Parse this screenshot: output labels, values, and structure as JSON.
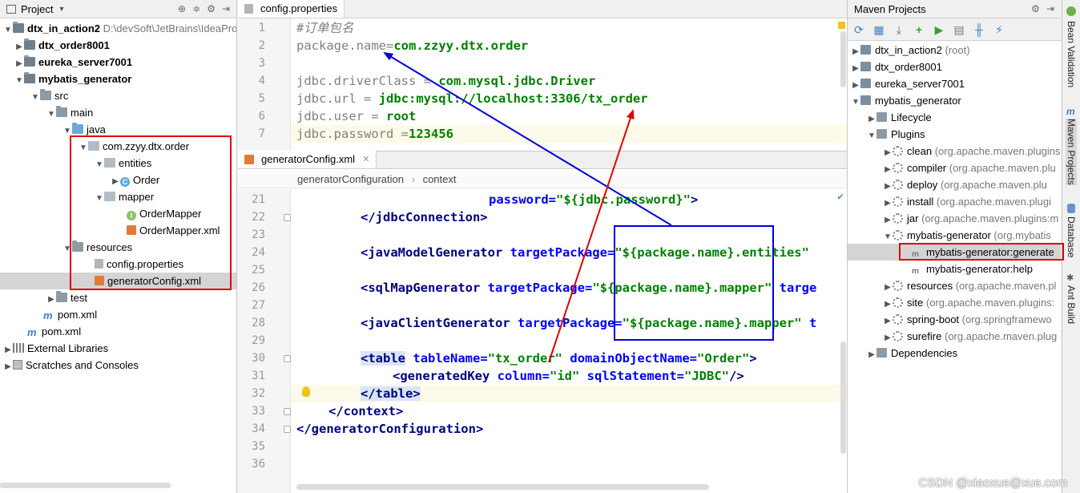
{
  "project": {
    "header_title": "Project",
    "tree": [
      {
        "label": "dtx_in_action2",
        "path": "D:\\devSoft\\JetBrains\\IdeaPro"
      },
      {
        "label": "dtx_order8001"
      },
      {
        "label": "eureka_server7001"
      },
      {
        "label": "mybatis_generator"
      },
      {
        "label": "src"
      },
      {
        "label": "main"
      },
      {
        "label": "java"
      },
      {
        "label": "com.zzyy.dtx.order"
      },
      {
        "label": "entities"
      },
      {
        "label": "Order"
      },
      {
        "label": "mapper"
      },
      {
        "label": "OrderMapper"
      },
      {
        "label": "OrderMapper.xml"
      },
      {
        "label": "resources"
      },
      {
        "label": "config.properties"
      },
      {
        "label": "generatorConfig.xml"
      },
      {
        "label": "test"
      },
      {
        "label": "pom.xml"
      },
      {
        "label": "pom.xml"
      },
      {
        "label": "External Libraries"
      },
      {
        "label": "Scratches and Consoles"
      }
    ]
  },
  "editor_top": {
    "tab": "config.properties",
    "lines": [
      {
        "n": "1",
        "comment": "#订单包名"
      },
      {
        "n": "2",
        "key": "package.name",
        "eq": "=",
        "value": "com.zzyy.dtx.order"
      },
      {
        "n": "3"
      },
      {
        "n": "4",
        "key": "jdbc.driverClass",
        "eq": " = ",
        "value": "com.mysql.jdbc.Driver"
      },
      {
        "n": "5",
        "key": "jdbc.url",
        "eq": " = ",
        "value": "jdbc:mysql://localhost:3306/tx_order"
      },
      {
        "n": "6",
        "key": "jdbc.user",
        "eq": " = ",
        "value": "root"
      },
      {
        "n": "7",
        "key": "jdbc.password",
        "eq": " =",
        "value": "123456"
      }
    ]
  },
  "editor_bottom": {
    "tab": "generatorConfig.xml",
    "breadcrumb": [
      "generatorConfiguration",
      "context"
    ],
    "line_numbers": [
      "21",
      "22",
      "23",
      "24",
      "25",
      "26",
      "27",
      "28",
      "29",
      "30",
      "31",
      "32",
      "33",
      "34",
      "35",
      "36"
    ],
    "l21_attr": "password=",
    "l21_val": "\"${jdbc.password}\"",
    "l21_end": ">",
    "l22": "</jdbcConnection>",
    "l24_tag": "<javaModelGenerator",
    "l24_attr": "targetPackage=",
    "l24_val": "\"${package.name}.entities\"",
    "l26_tag": "<sqlMapGenerator",
    "l26_attr": "targetPackage=",
    "l26_val": "\"${package.name}.mapper\"",
    "l26_attr2": "targe",
    "l28_tag": "<javaClientGenerator",
    "l28_attr": "targetPackage=",
    "l28_val": "\"${package.name}.mapper\"",
    "l28_attr2": "t",
    "l30_open": "<",
    "l30_tag": "table",
    "l30_attr1": "tableName=",
    "l30_val1": "\"tx_order\"",
    "l30_attr2": "domainObjectName=",
    "l30_val2": "\"Order\"",
    "l30_end": ">",
    "l31_tag": "<generatedKey",
    "l31_attr1": "column=",
    "l31_val1": "\"id\"",
    "l31_attr2": "sqlStatement=",
    "l31_val2": "\"JDBC\"",
    "l31_end": "/>",
    "l32": "</table>",
    "l33": "</context>",
    "l34": "</generatorConfiguration>"
  },
  "maven": {
    "header_title": "Maven Projects",
    "tree": [
      {
        "label": "dtx_in_action2",
        "note": "(root)"
      },
      {
        "label": "dtx_order8001"
      },
      {
        "label": "eureka_server7001"
      },
      {
        "label": "mybatis_generator"
      },
      {
        "label": "Lifecycle"
      },
      {
        "label": "Plugins"
      },
      {
        "label": "clean",
        "note": "(org.apache.maven.plugins"
      },
      {
        "label": "compiler",
        "note": "(org.apache.maven.plu"
      },
      {
        "label": "deploy",
        "note": "(org.apache.maven.plu"
      },
      {
        "label": "install",
        "note": "(org.apache.maven.plugi"
      },
      {
        "label": "jar",
        "note": "(org.apache.maven.plugins:m"
      },
      {
        "label": "mybatis-generator",
        "note": "(org.mybatis"
      },
      {
        "label": "mybatis-generator:generate"
      },
      {
        "label": "mybatis-generator:help"
      },
      {
        "label": "resources",
        "note": "(org.apache.maven.pl"
      },
      {
        "label": "site",
        "note": "(org.apache.maven.plugins:"
      },
      {
        "label": "spring-boot",
        "note": "(org.springframewo"
      },
      {
        "label": "surefire",
        "note": "(org.apache.maven.plug"
      },
      {
        "label": "Dependencies"
      }
    ]
  },
  "side_tabs": [
    "Bean Validation",
    "Maven Projects",
    "Database",
    "Ant Build"
  ],
  "watermark": "CSDN @xiaoxue@xue.com",
  "colors": {
    "red_annotation": "#e00000",
    "blue_annotation": "#0000dd"
  }
}
